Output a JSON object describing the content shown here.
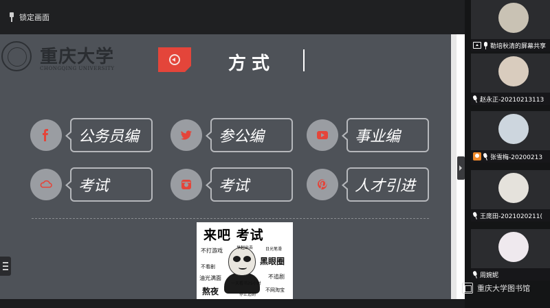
{
  "toolbar": {
    "lock_label": "锁定画面"
  },
  "slide": {
    "logo_text": "重庆大学",
    "logo_sub": "CHONGQING UNIVERSITY",
    "title": "方式",
    "items": [
      {
        "icon": "facebook-icon",
        "label": "公务员编"
      },
      {
        "icon": "twitter-icon",
        "label": "参公编"
      },
      {
        "icon": "youtube-icon",
        "label": "事业编"
      },
      {
        "icon": "cloud-icon",
        "label": "考试"
      },
      {
        "icon": "instagram-icon",
        "label": "考试"
      },
      {
        "icon": "pinterest-icon",
        "label": "人才引进"
      }
    ],
    "meme": {
      "title": "来吧 考试",
      "words": [
        "不打游戏",
        "早起出去",
        "日光笔滑",
        "黑眼圈",
        "不看剧",
        "油光满面",
        "不追剧",
        "一天看书25小时",
        "熬夜",
        "停止追剧",
        "不网淘宝"
      ]
    }
  },
  "participants": [
    {
      "name": "勒培秋清的屏幕共享",
      "icon": "screen-share-icon"
    },
    {
      "name": "赵永正-20210213113",
      "icon": "mic-muted-icon"
    },
    {
      "name": "张雪梅-20200213",
      "icon": "user-icon"
    },
    {
      "name": "王庞田-2021020211(",
      "icon": "mic-muted-icon"
    },
    {
      "name": "周婉妮",
      "icon": "mic-muted-icon"
    }
  ],
  "watermark": {
    "text": "重庆大学图书馆"
  },
  "colors": {
    "accent": "#e4453a",
    "slide_bg": "#4e5258",
    "circle": "#9a9da2"
  }
}
